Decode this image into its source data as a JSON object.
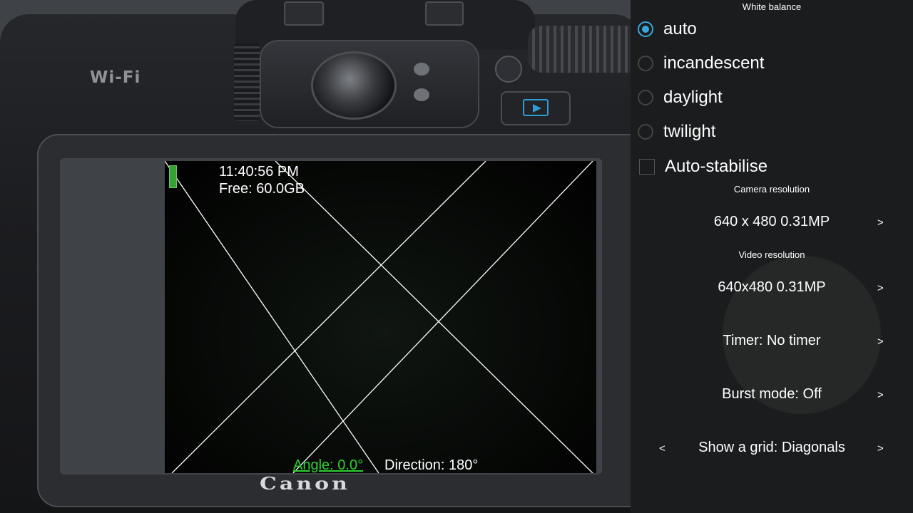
{
  "hud": {
    "time": "11:40:56 PM",
    "free_space": "Free: 60.0GB",
    "angle": "Angle: 0.0°",
    "direction": "Direction: 180°"
  },
  "camera_decor": {
    "wifi_label": "Wi-Fi",
    "brand": "Canon"
  },
  "settings": {
    "white_balance": {
      "title": "White balance",
      "options": [
        "auto",
        "incandescent",
        "daylight",
        "twilight"
      ],
      "selected": "auto"
    },
    "auto_stabilise": {
      "label": "Auto-stabilise",
      "checked": false
    },
    "camera_resolution": {
      "title": "Camera resolution",
      "value": "640 x 480 0.31MP",
      "next": ">"
    },
    "video_resolution": {
      "title": "Video resolution",
      "value": "640x480 0.31MP",
      "next": ">"
    },
    "timer": {
      "value": "Timer: No timer",
      "next": ">"
    },
    "burst_mode": {
      "value": "Burst mode: Off",
      "next": ">"
    },
    "grid": {
      "value": "Show a grid: Diagonals",
      "prev": "<",
      "next": ">"
    }
  },
  "colors": {
    "accent": "#3aa6dd",
    "angle_text": "#2fd12f",
    "battery": "#35a135",
    "panel_bg": "#18191b"
  }
}
